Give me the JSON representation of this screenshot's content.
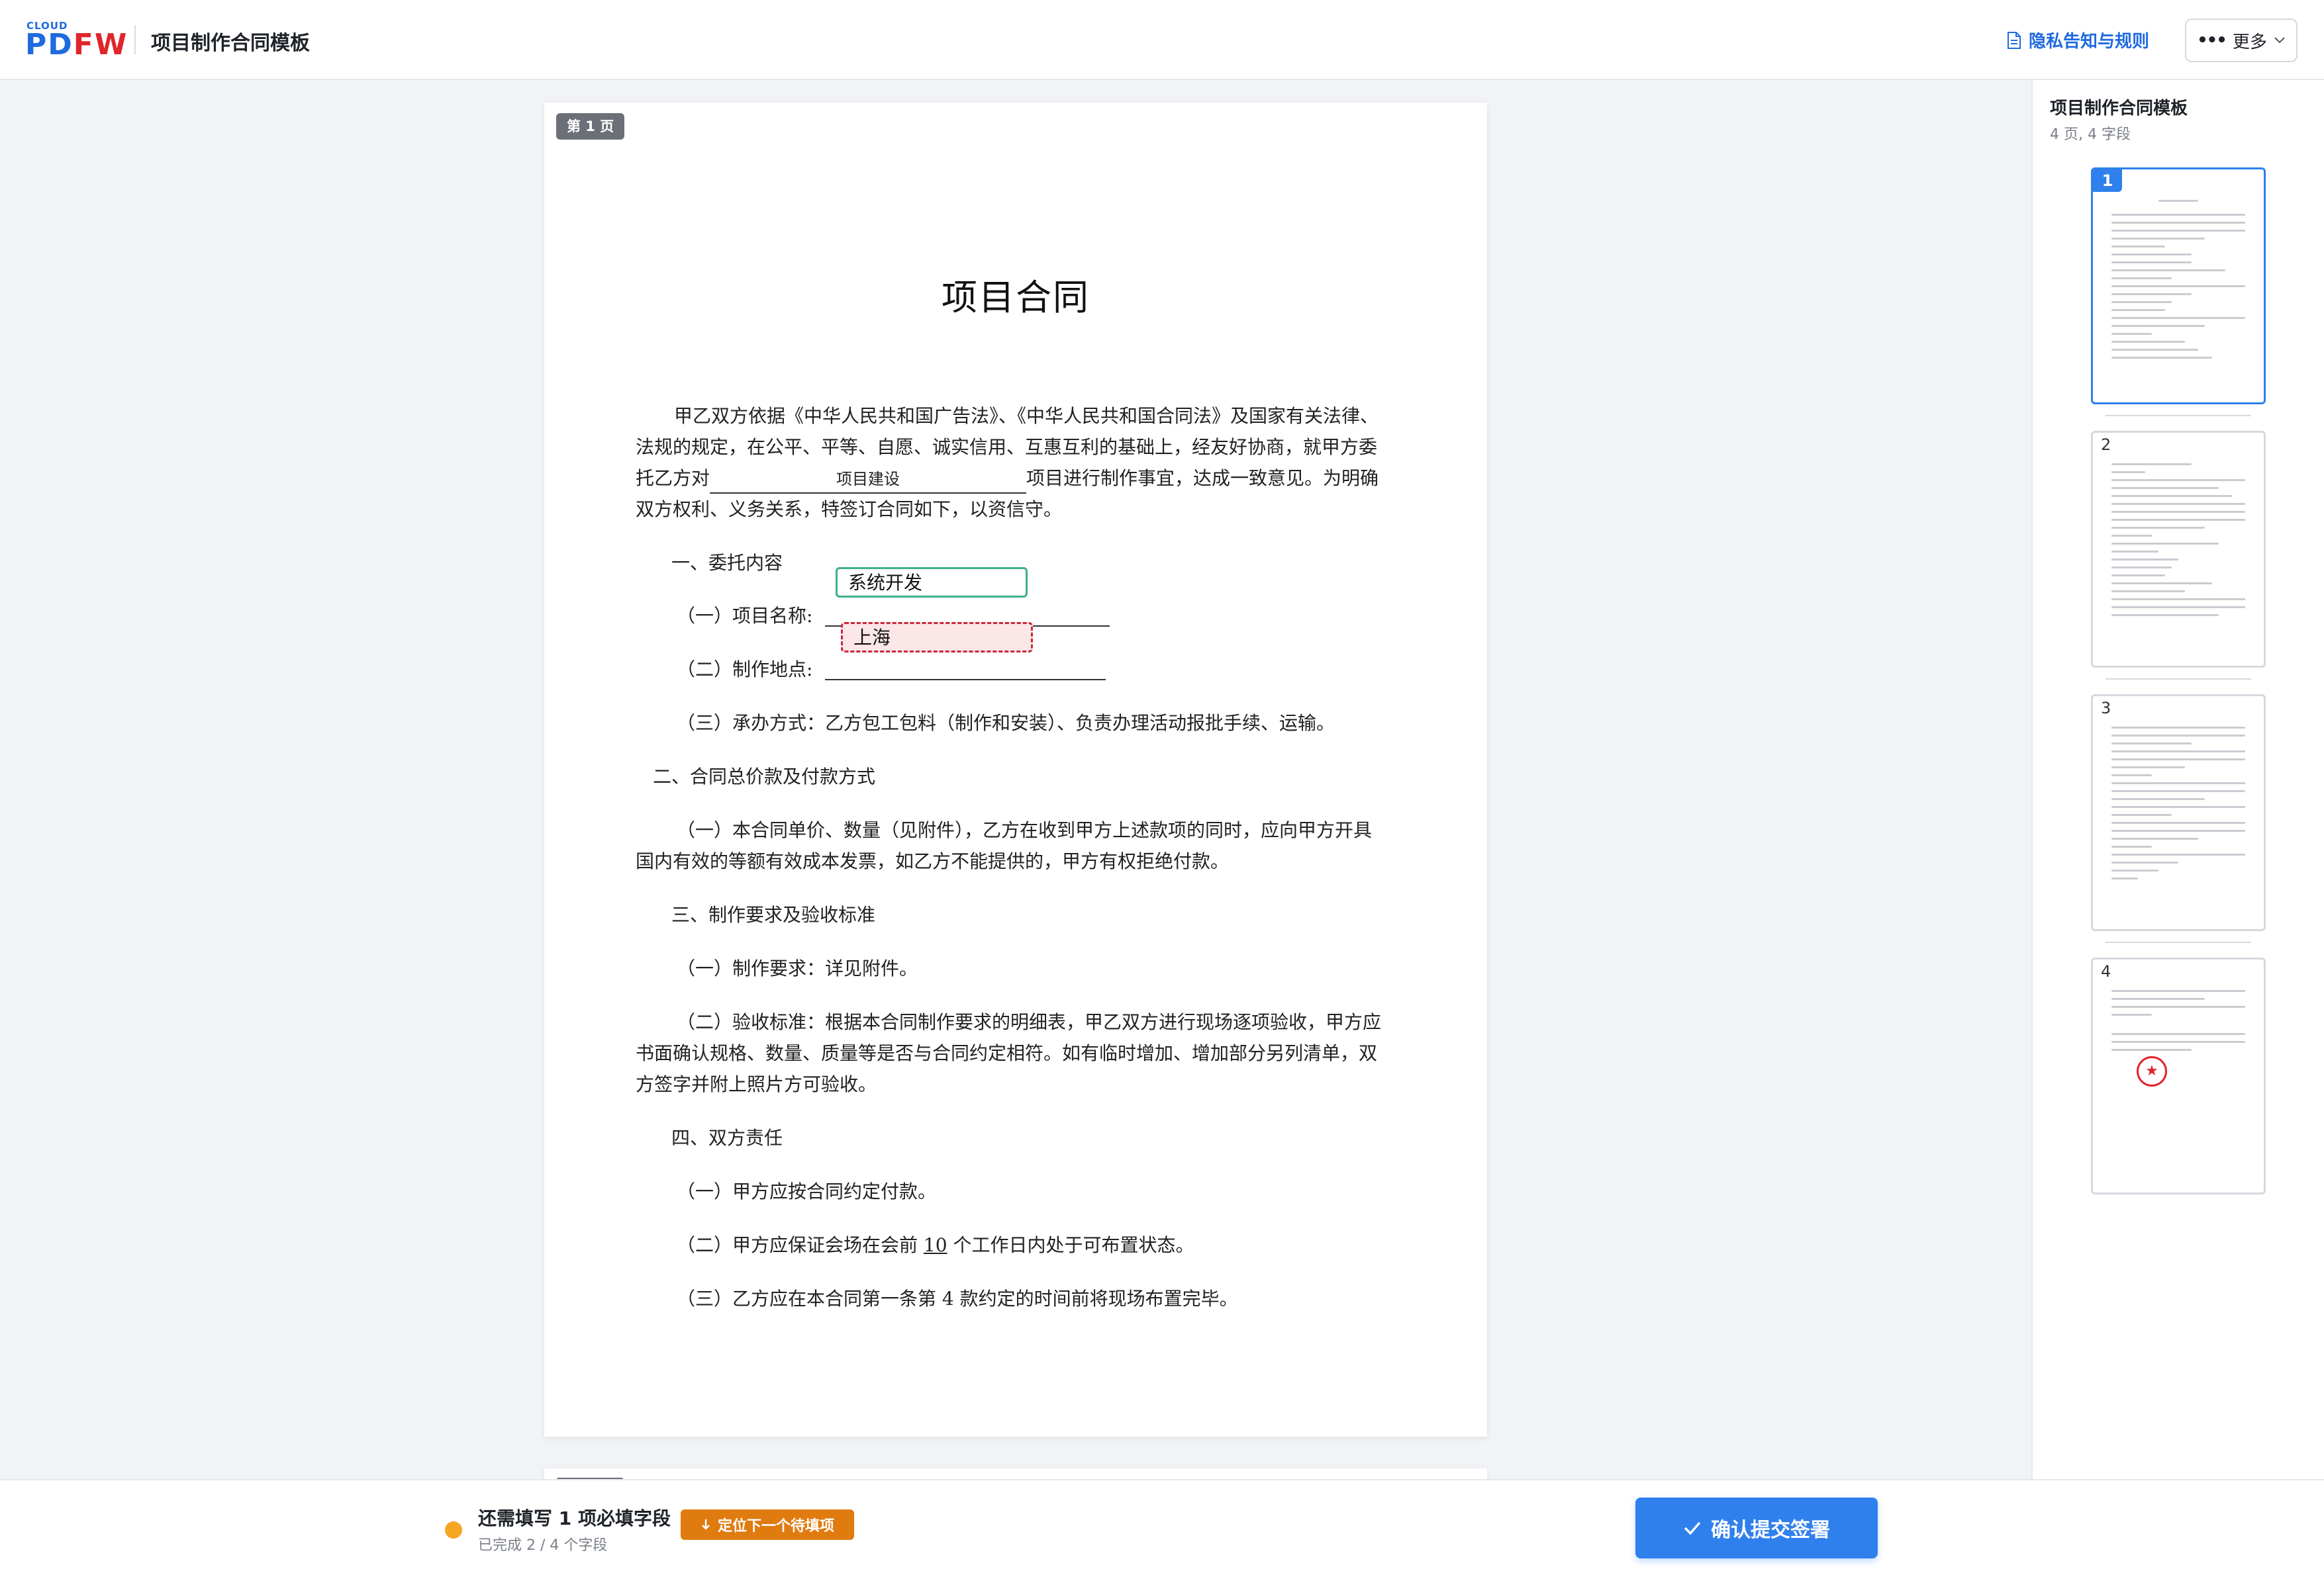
{
  "header": {
    "logo_top": "CLOUD",
    "logo_pd": "PD",
    "logo_fw": "FW",
    "title": "项目制作合同模板",
    "privacy_link": "隐私告知与规则",
    "more_label": "更多"
  },
  "document": {
    "page_tag": "第 1 页",
    "title": "项目合同",
    "intro_line1": "甲乙双方依据《中华人民共和国广告法》、《中华人民共和国合同法》及国家有关法律、",
    "intro_line2": "法规的规定，在公平、平等、自愿、诚实信用、互惠互利的基础上，经友好协商，就甲方委",
    "intro_line3_pre": "托乙方对",
    "intro_line3_fill": "项目建设",
    "intro_line3_post": "项目进行制作事宜，达成一致意见。为明确",
    "intro_line4": "双方权利、义务关系，特签订合同如下，以资信守。",
    "sec1_title": "一、委托内容",
    "item1_label": "（一）项目名称:",
    "item1_value": "系统开发",
    "item2_label": "（二）制作地点:",
    "item2_value": "上海",
    "item3": "（三）承办方式：乙方包工包料（制作和安装）、负责办理活动报批手续、运输。",
    "sec2_title": "二、合同总价款及付款方式",
    "sec2_p1": "（一）本合同单价、数量（见附件），乙方在收到甲方上述款项的同时，应向甲方开具",
    "sec2_p2": "国内有效的等额有效成本发票，如乙方不能提供的，甲方有权拒绝付款。",
    "sec3_title": "三、制作要求及验收标准",
    "sec3_item1": "（一）制作要求：详见附件。",
    "sec3_item2_l1": "（二）验收标准：根据本合同制作要求的明细表，甲乙双方进行现场逐项验收，甲方应",
    "sec3_item2_l2": "书面确认规格、数量、质量等是否与合同约定相符。如有临时增加、增加部分另列清单，双",
    "sec3_item2_l3": "方签字并附上照片方可验收。",
    "sec4_title": "四、双方责任",
    "sec4_item1": "（一）甲方应按合同约定付款。",
    "sec4_item2_pre": "（二）甲方应保证会场在会前 ",
    "sec4_item2_num": "10",
    "sec4_item2_post": " 个工作日内处于可布置状态。",
    "sec4_item3": "（三）乙方应在本合同第一条第 4 款约定的时间前将现场布置完毕。"
  },
  "sidebar": {
    "title": "项目制作合同模板",
    "subtitle": "4 页, 4 字段",
    "thumbnails": [
      {
        "num": "1"
      },
      {
        "num": "2"
      },
      {
        "num": "3"
      },
      {
        "num": "4"
      }
    ],
    "seal_glyph": "★"
  },
  "footer": {
    "status_main": "还需填写 1 项必填字段",
    "status_sub": "已完成 2 / 4 个字段",
    "locate_button": "定位下一个待填项",
    "submit_button": "确认提交签署"
  },
  "colors": {
    "accent": "#2f80ed",
    "warning": "#f5a623",
    "locate": "#e07b10",
    "field_filled_border": "#3fae8c",
    "field_active_border": "#c8283a"
  }
}
